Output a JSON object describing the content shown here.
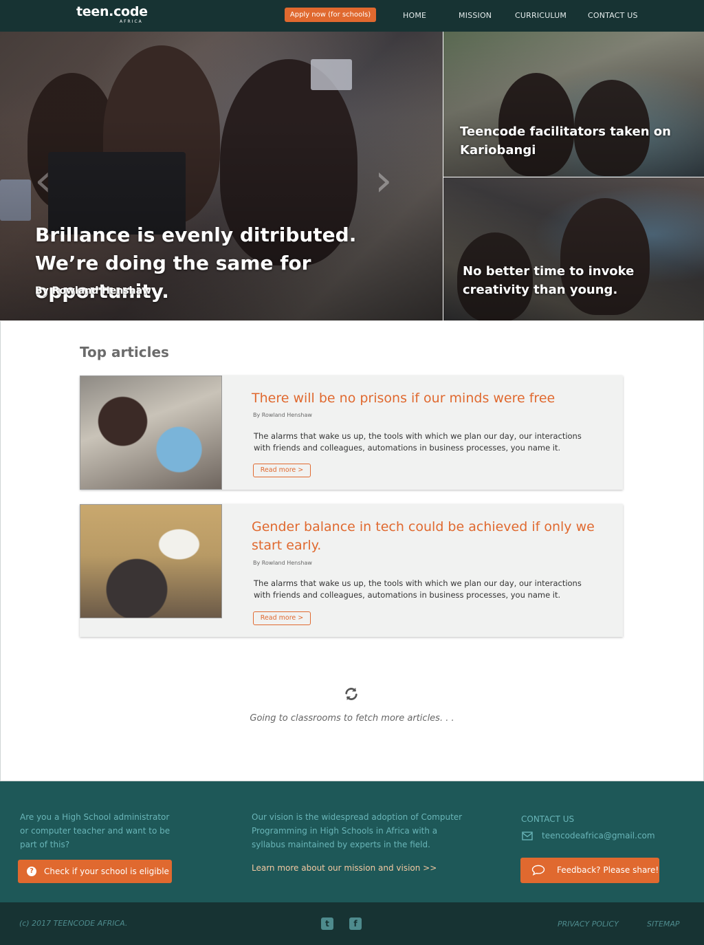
{
  "nav": {
    "logo_main": "teen.code",
    "logo_sub": "AFRICA",
    "apply_label": "Apply now (for schools)",
    "links": [
      "HOME",
      "MISSION",
      "CURRICULUM",
      "CONTACT US"
    ]
  },
  "hero": {
    "main_title": "Brillance is evenly ditributed. We’re doing the same for opportunity.",
    "main_byline": "By Rowland Henshaw",
    "prev_arrow": "‹",
    "next_arrow": "›",
    "side1_title": "Teencode facilitators taken on Kariobangi",
    "side2_title": "No better time to invoke creativity than young."
  },
  "articles": {
    "section_title": "Top articles",
    "items": [
      {
        "title": "There will be no prisons if our minds were free",
        "author": "By Rowland Henshaw",
        "excerpt": "The alarms that wake us up, the tools with which we plan our day, our interactions with friends and colleagues, automations in business processes, you name it.",
        "read_more": "Read more >"
      },
      {
        "title": "Gender balance in tech could be achieved if only we start early.",
        "author": "By Rowland Henshaw",
        "excerpt": "The alarms that wake us up, the tools with which we plan our day, our interactions with friends and colleagues, automations in business processes, you name it.",
        "read_more": "Read more >"
      }
    ],
    "loading_text": "Going to classrooms to fetch more articles. . ."
  },
  "footer": {
    "admin_text": "Are you a High School administrator or computer teacher and want to be part of this?",
    "eligible_button": "Check if your school is eligible",
    "vision_text": "Our vision is the widespread adoption of Computer Programming in High Schools in Africa with a syllabus maintained by experts in the field.",
    "vision_link": "Learn more about our mission and vision >>",
    "contact_heading": "CONTACT US",
    "email": "teencodeafrica@gmail.com",
    "feedback_button": "Feedback? Please share!",
    "copyright": "(c) 2017 TEENCODE AFRICA.",
    "privacy": "PRIVACY POLICY",
    "sitemap": "SITEMAP"
  },
  "colors": {
    "nav_bg": "#173333",
    "accent": "#e0692f",
    "footer_bg": "#1e5858",
    "footer_text": "#69b5b8"
  },
  "icons": {
    "loader": "refresh-icon",
    "email": "envelope-icon",
    "feedback": "speech-bubble-icon",
    "eligible": "question-circle-icon",
    "twitter": "twitter-icon",
    "facebook": "facebook-icon"
  }
}
